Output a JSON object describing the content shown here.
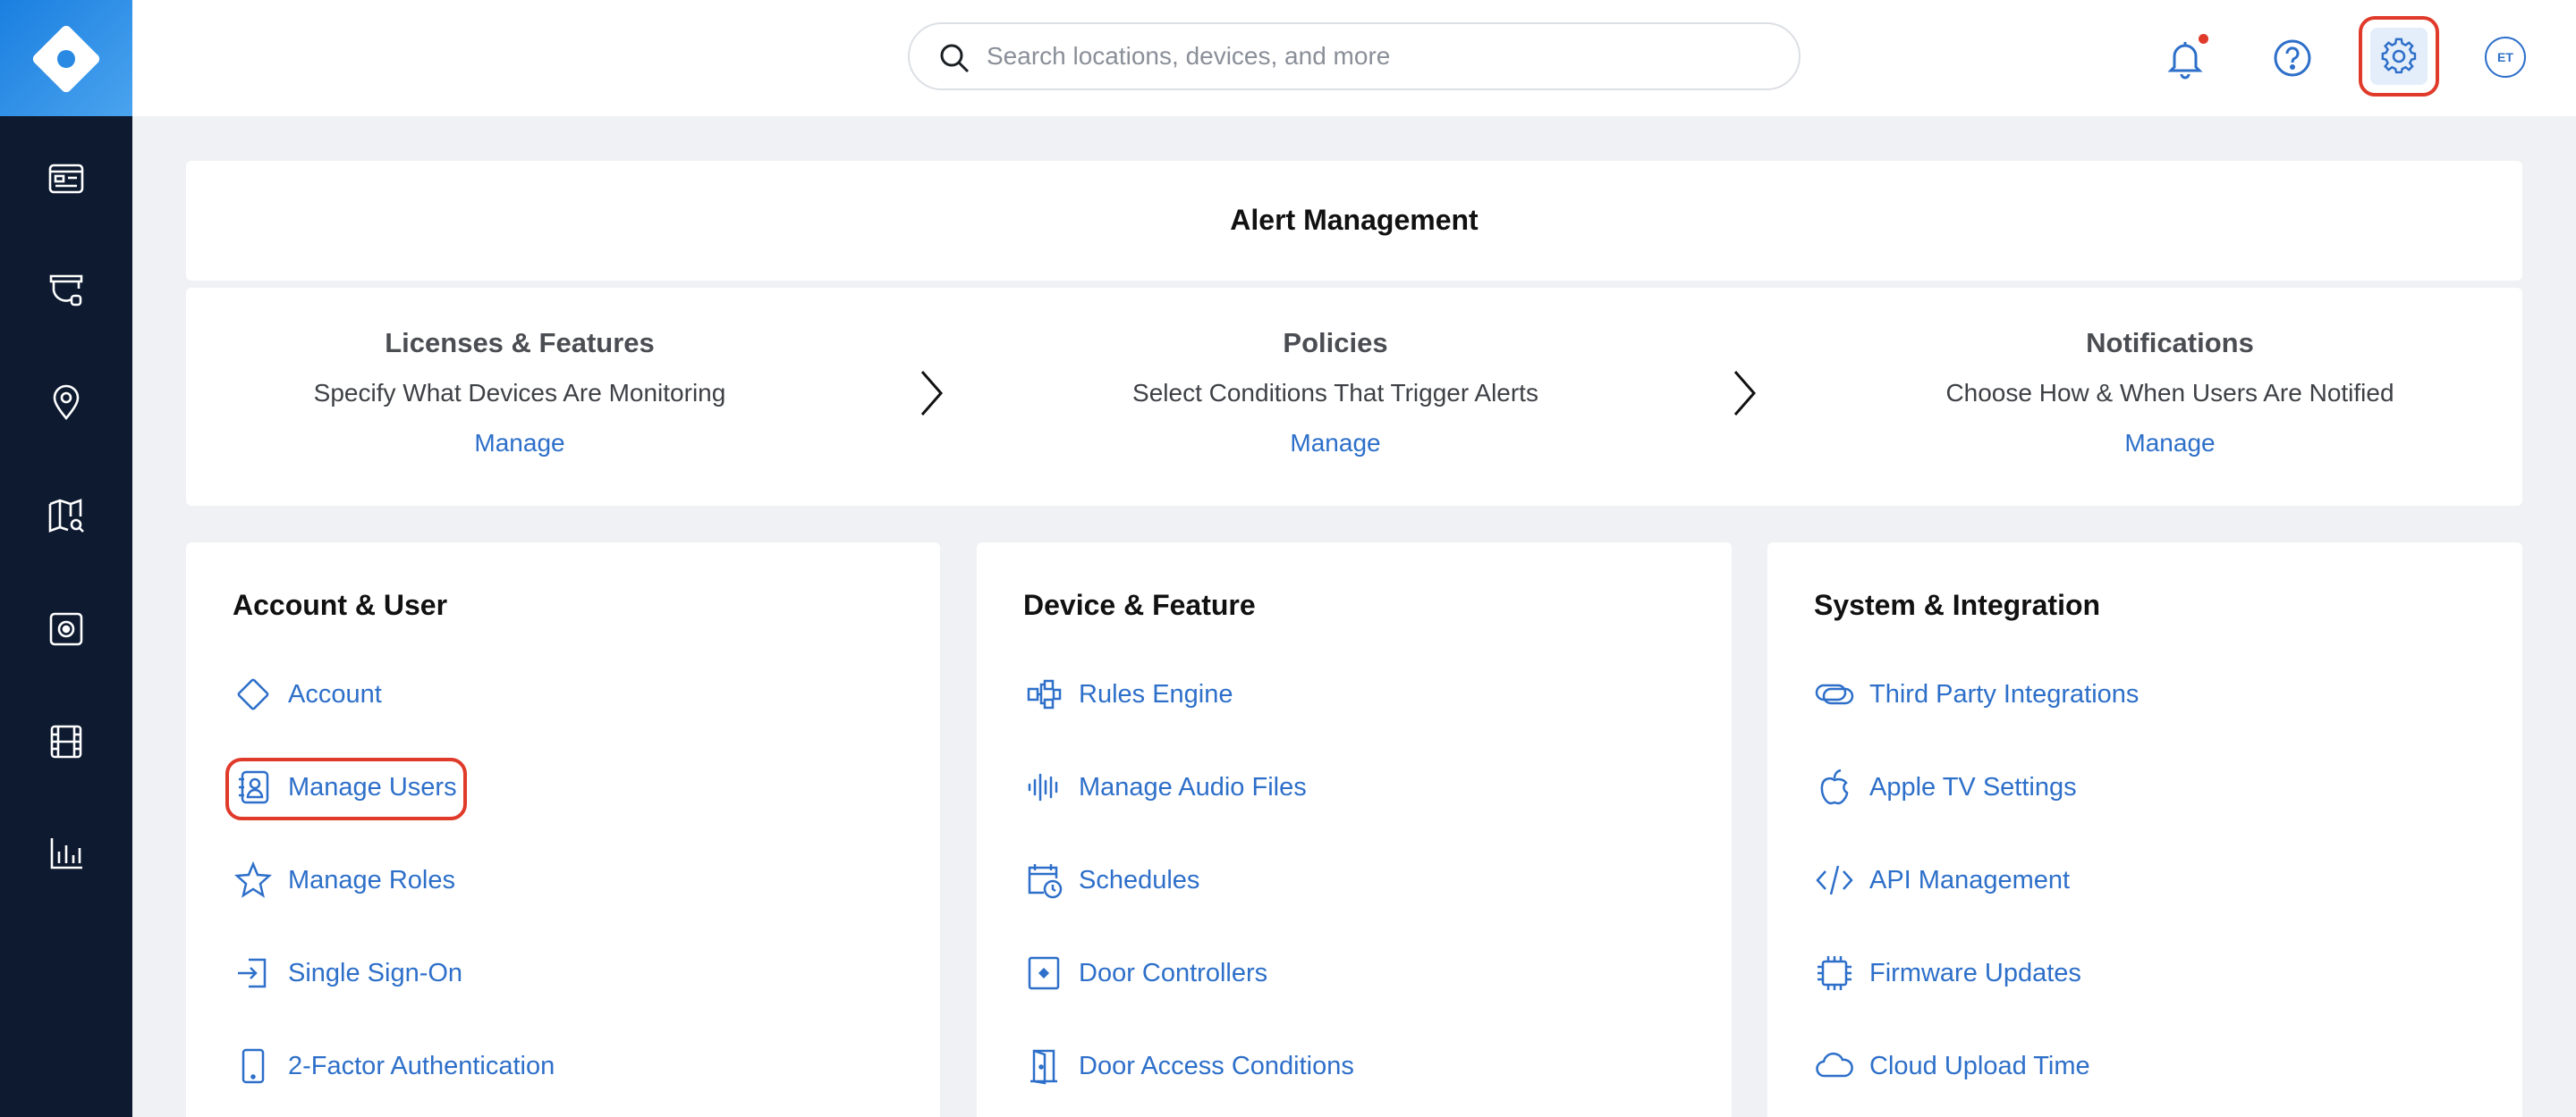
{
  "search": {
    "placeholder": "Search locations, devices, and more"
  },
  "user": {
    "initials": "ET"
  },
  "colors": {
    "accent": "#2d6fc9",
    "sidebar": "#0d1a30",
    "highlight": "#e03a2a",
    "notification_dot": "#e03a2a"
  },
  "sidebar": {
    "items": [
      {
        "icon": "dashboard-icon"
      },
      {
        "icon": "camera-icon"
      },
      {
        "icon": "location-pin-icon"
      },
      {
        "icon": "map-search-icon"
      },
      {
        "icon": "access-control-icon"
      },
      {
        "icon": "film-icon"
      },
      {
        "icon": "bar-chart-icon"
      }
    ]
  },
  "alert_management": {
    "title": "Alert Management",
    "steps": [
      {
        "title": "Licenses & Features",
        "description": "Specify What Devices Are Monitoring",
        "link": "Manage"
      },
      {
        "title": "Policies",
        "description": "Select Conditions That Trigger Alerts",
        "link": "Manage"
      },
      {
        "title": "Notifications",
        "description": "Choose How & When Users Are Notified",
        "link": "Manage"
      }
    ]
  },
  "sections": [
    {
      "title": "Account & User",
      "items": [
        {
          "label": "Account",
          "icon": "diamond-icon"
        },
        {
          "label": "Manage Users",
          "icon": "user-directory-icon",
          "highlighted": true
        },
        {
          "label": "Manage Roles",
          "icon": "star-icon"
        },
        {
          "label": "Single Sign-On",
          "icon": "sign-in-icon"
        },
        {
          "label": "2-Factor Authentication",
          "icon": "phone-icon"
        }
      ]
    },
    {
      "title": "Device & Feature",
      "items": [
        {
          "label": "Rules Engine",
          "icon": "flow-icon"
        },
        {
          "label": "Manage Audio Files",
          "icon": "audio-wave-icon"
        },
        {
          "label": "Schedules",
          "icon": "calendar-clock-icon"
        },
        {
          "label": "Door Controllers",
          "icon": "door-controller-icon"
        },
        {
          "label": "Door Access Conditions",
          "icon": "door-icon"
        }
      ]
    },
    {
      "title": "System & Integration",
      "items": [
        {
          "label": "Third Party Integrations",
          "icon": "link-icon"
        },
        {
          "label": "Apple TV Settings",
          "icon": "apple-icon"
        },
        {
          "label": "API Management",
          "icon": "code-icon"
        },
        {
          "label": "Firmware Updates",
          "icon": "chip-icon"
        },
        {
          "label": "Cloud Upload Time",
          "icon": "cloud-icon"
        }
      ]
    }
  ]
}
